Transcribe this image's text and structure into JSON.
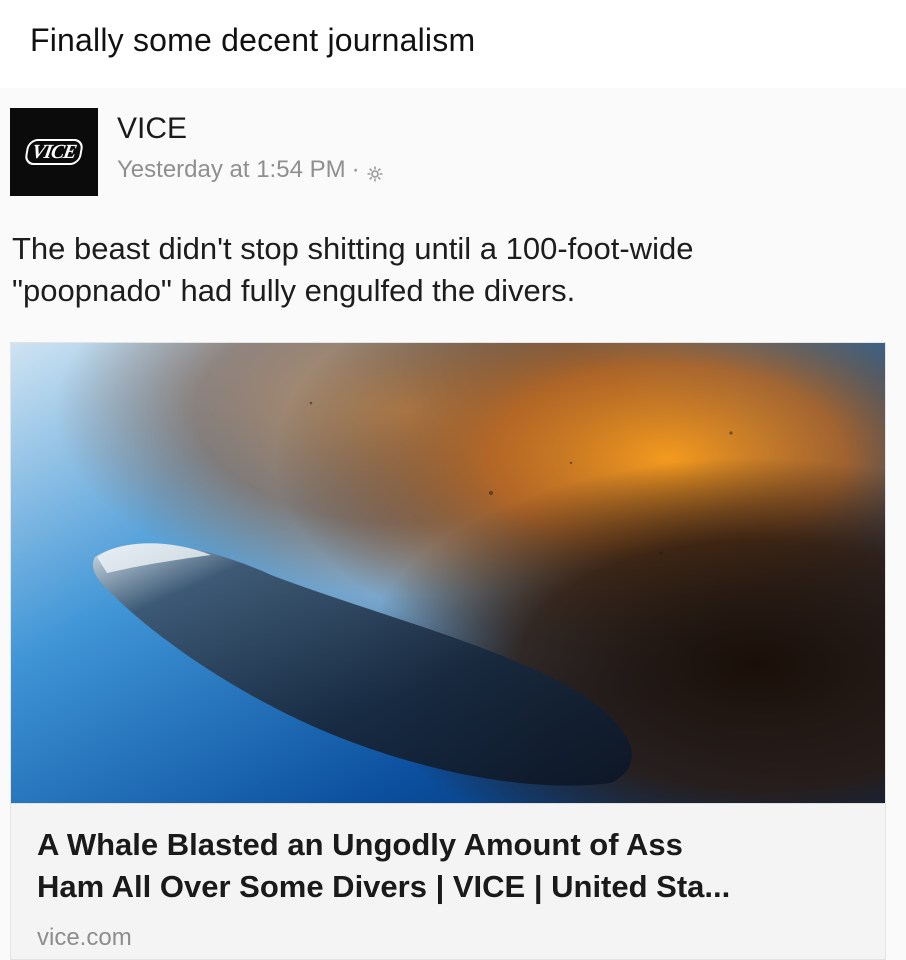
{
  "meme": {
    "caption": "Finally some decent journalism"
  },
  "post": {
    "avatar_logo_text": "VICE",
    "page_name": "VICE",
    "timestamp": "Yesterday at 1:54 PM",
    "separator": "·",
    "privacy_icon": "gear-icon",
    "text_line1": "The beast didn't stop shitting until a 100-foot-wide",
    "text_line2": "\"poopnado\" had fully engulfed the divers."
  },
  "link_preview": {
    "image_description_icon": "whale-photo",
    "title_line1": "A Whale Blasted an Ungodly Amount of Ass",
    "title_line2": "Ham All Over Some Divers | VICE | United Sta...",
    "domain": "vice.com"
  }
}
